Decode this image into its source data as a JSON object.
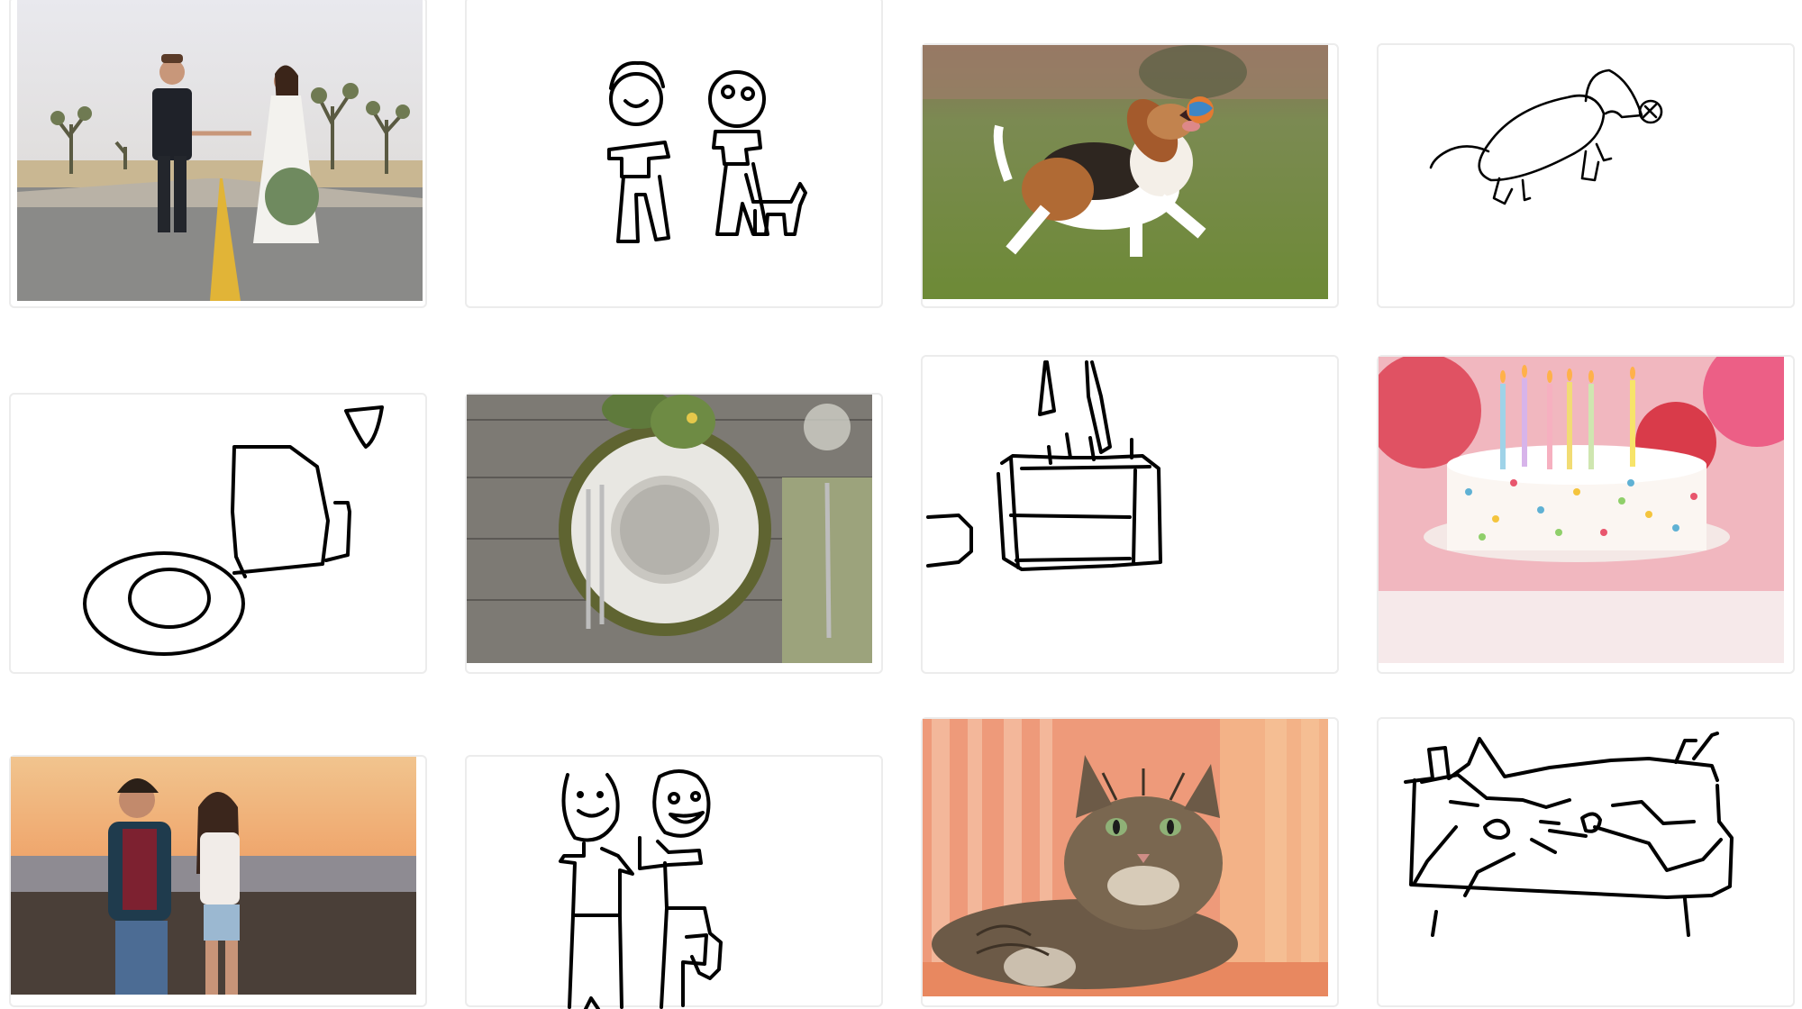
{
  "grid": {
    "columns": 4,
    "rows": 3,
    "tiles": [
      {
        "kind": "photo",
        "subject": "wedding-couple-on-road"
      },
      {
        "kind": "sketch",
        "subject": "two-figures-with-dog"
      },
      {
        "kind": "photo",
        "subject": "beagle-catching-ball"
      },
      {
        "kind": "sketch",
        "subject": "dog-with-ball"
      },
      {
        "kind": "sketch",
        "subject": "plate-fork-glass"
      },
      {
        "kind": "photo",
        "subject": "table-setting-plate-fork-knife"
      },
      {
        "kind": "sketch",
        "subject": "cake-with-candles"
      },
      {
        "kind": "photo",
        "subject": "birthday-cake-with-candles"
      },
      {
        "kind": "photo",
        "subject": "couple-on-beach"
      },
      {
        "kind": "sketch",
        "subject": "two-smiling-figures"
      },
      {
        "kind": "photo",
        "subject": "tabby-cat-lying"
      },
      {
        "kind": "sketch",
        "subject": "cat-in-basket"
      }
    ]
  },
  "colors": {
    "card_border": "#ececec",
    "sketch_stroke": "#000000",
    "background": "#ffffff"
  }
}
